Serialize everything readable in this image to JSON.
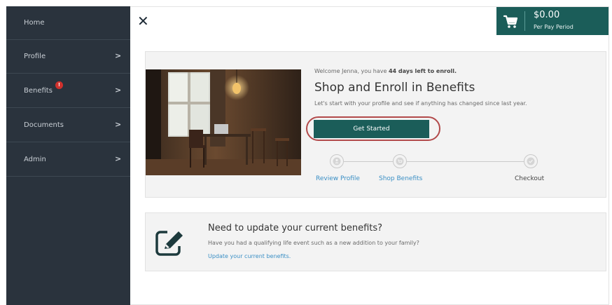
{
  "sidebar": {
    "items": [
      {
        "label": "Home"
      },
      {
        "label": "Profile",
        "chevron": ">"
      },
      {
        "label": "Benefits",
        "chevron": ">",
        "badge": "!"
      },
      {
        "label": "Documents",
        "chevron": ">"
      },
      {
        "label": "Admin",
        "chevron": ">"
      }
    ]
  },
  "topbar": {
    "close_glyph": "✕",
    "cart": {
      "amount": "$0.00",
      "period": "Per Pay Period",
      "icon": "cart-icon"
    }
  },
  "hero": {
    "welcome_prefix": "Welcome Jenna, you have ",
    "welcome_bold": "44 days left to enroll.",
    "title": "Shop and Enroll in Benefits",
    "subtitle": "Let's start with your profile and see if anything has changed since last year.",
    "button_label": "Get Started",
    "steps": [
      {
        "label": "Review Profile",
        "icon": "person-icon"
      },
      {
        "label": "Shop Benefits",
        "icon": "cart-icon"
      },
      {
        "label": "Checkout",
        "icon": "checkmark-icon"
      }
    ]
  },
  "update": {
    "title": "Need to update your current benefits?",
    "subtitle": "Have you had a qualifying life event such as a new addition to your family?",
    "link": "Update your current benefits.",
    "icon": "edit-icon"
  },
  "colors": {
    "sidebar_bg": "#2a333d",
    "accent": "#1b5d59",
    "link": "#3a8fc5",
    "badge": "#d0312d",
    "highlight_ring": "#b2494a"
  }
}
